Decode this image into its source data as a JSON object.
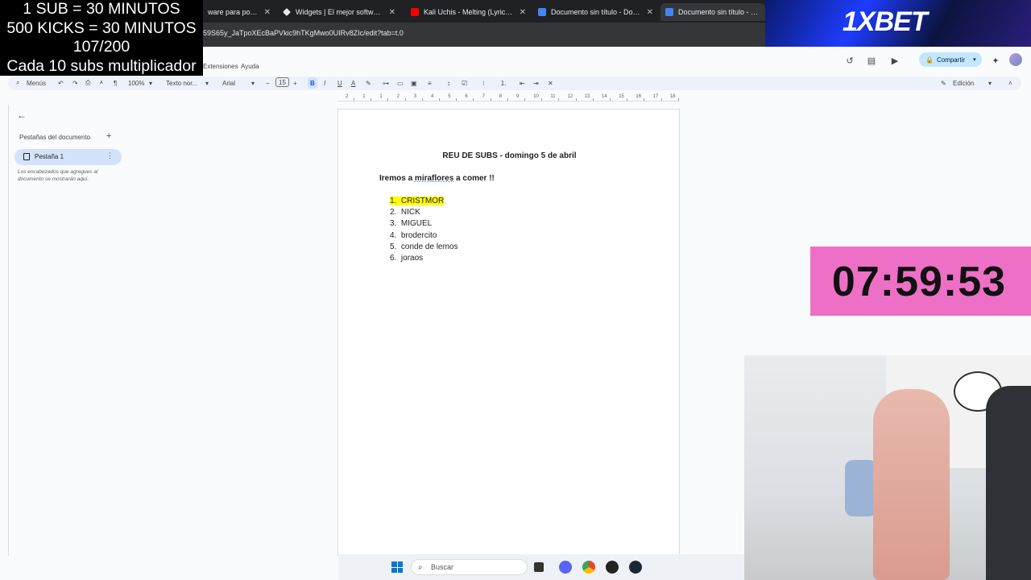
{
  "overlay": {
    "lines": [
      "1 SUB      = 30 MINUTOS",
      "500 KICKS = 30 MINUTOS",
      "107/200",
      "Cada 10 subs multiplicador"
    ],
    "brand": "1XBET",
    "timer": "07:59:53"
  },
  "browser": {
    "tabs": [
      {
        "title": "ware para potencia",
        "active": false
      },
      {
        "title": "Widgets | El mejor software pa",
        "active": false
      },
      {
        "title": "Kali Uchis - Melting (Lyrics) - Yo",
        "active": false
      },
      {
        "title": "Documento sin título - Docume",
        "active": false
      },
      {
        "title": "Documento sin título - Docum",
        "active": true
      }
    ],
    "close_glyph": "✕",
    "url": "59S65y_JaTpoXEcBaPVkic9hTKgMwo0UIRv8ZIc/edit?tab=t.0"
  },
  "docs": {
    "menus": [
      "Extensiones",
      "Ayuda"
    ],
    "share_label": "Compartir",
    "toolbar": {
      "menus_label": "Menús",
      "zoom": "100%",
      "style": "Texto nor...",
      "font": "Arial",
      "font_size": "15",
      "mode": "Edición"
    },
    "ruler": [
      "2",
      "1",
      "1",
      "2",
      "3",
      "4",
      "5",
      "6",
      "7",
      "8",
      "9",
      "10",
      "11",
      "12",
      "13",
      "14",
      "15",
      "16",
      "17",
      "18"
    ],
    "sidebar": {
      "title": "Pestañas del documento",
      "tab_label": "Pestaña 1",
      "hint": "Los encabezados que agregues al documento se mostrarán aquí."
    },
    "content": {
      "title": "REU DE SUBS - domingo 5 de abril",
      "line_before": "Iremos a ",
      "line_link": "miraflores",
      "line_after": " a comer !!",
      "items": [
        "CRISTMOR",
        "NICK",
        "MIGUEL",
        "brodercito",
        "conde de lemos",
        "joraos"
      ]
    }
  },
  "taskbar": {
    "search_placeholder": "Buscar"
  },
  "colors": {
    "timer_bg": "#ee70c6",
    "highlight": "#ffff00",
    "share_bg": "#c2e7ff"
  }
}
